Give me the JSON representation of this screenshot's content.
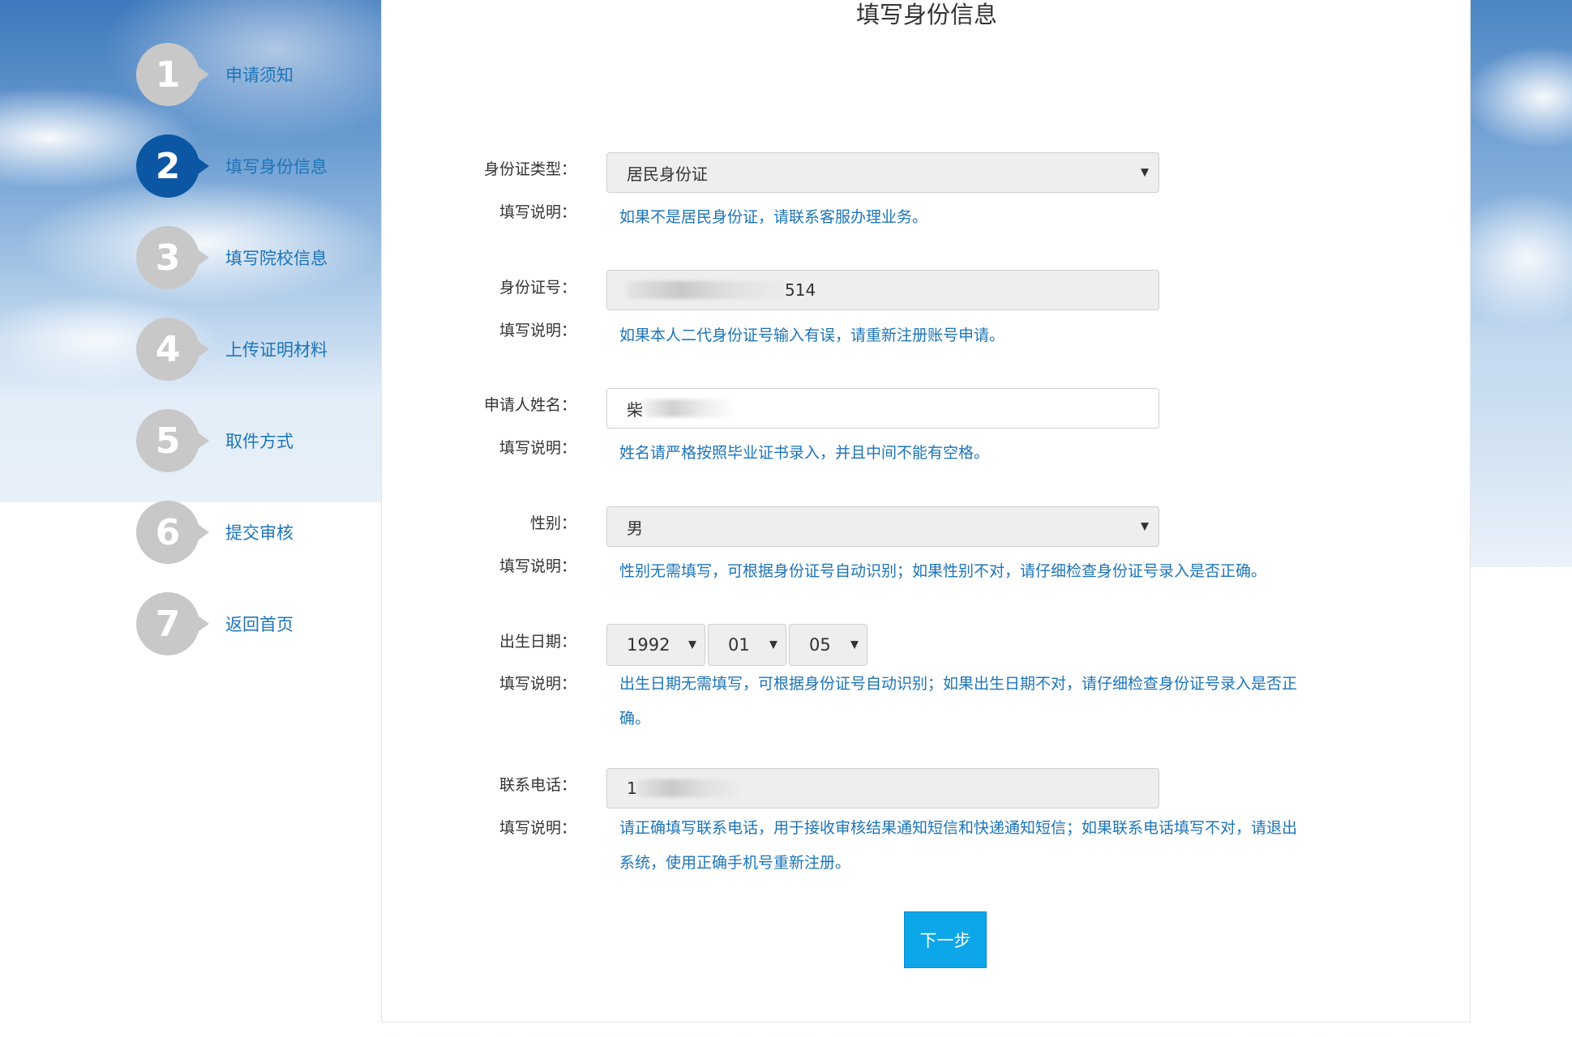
{
  "steps": [
    {
      "number": "1",
      "label": "申请须知",
      "active": false
    },
    {
      "number": "2",
      "label": "填写身份信息",
      "active": true
    },
    {
      "number": "3",
      "label": "填写院校信息",
      "active": false
    },
    {
      "number": "4",
      "label": "上传证明材料",
      "active": false
    },
    {
      "number": "5",
      "label": "取件方式",
      "active": false
    },
    {
      "number": "6",
      "label": "提交审核",
      "active": false
    },
    {
      "number": "7",
      "label": "返回首页",
      "active": false
    }
  ],
  "page_title": "填写身份信息",
  "hint_label": "填写说明：",
  "form": {
    "id_type": {
      "label": "身份证类型：",
      "value": "居民身份证",
      "hint": "如果不是居民身份证，请联系客服办理业务。"
    },
    "id_number": {
      "label": "身份证号：",
      "value_visible": "514",
      "hint": "如果本人二代身份证号输入有误，请重新注册账号申请。"
    },
    "name": {
      "label": "申请人姓名：",
      "value_visible": "柴",
      "hint": "姓名请严格按照毕业证书录入，并且中间不能有空格。"
    },
    "gender": {
      "label": "性别：",
      "value": "男",
      "hint": "性别无需填写，可根据身份证号自动识别；如果性别不对，请仔细检查身份证号录入是否正确。"
    },
    "birth_date": {
      "label": "出生日期：",
      "year": "1992",
      "month": "01",
      "day": "05",
      "hint_line1": "出生日期无需填写，可根据身份证号自动识别；如果出生日期不对，请仔细检查身份证号录入是否正",
      "hint_line2": "确。"
    },
    "phone": {
      "label": "联系电话：",
      "value_visible": "1",
      "hint_line1": "请正确填写联系电话，用于接收审核结果通知短信和快递通知短信；如果联系电话填写不对，请退出",
      "hint_line2": "系统，使用正确手机号重新注册。"
    }
  },
  "next_button": "下一步",
  "icons": {
    "dropdown": "caret-down-icon"
  }
}
